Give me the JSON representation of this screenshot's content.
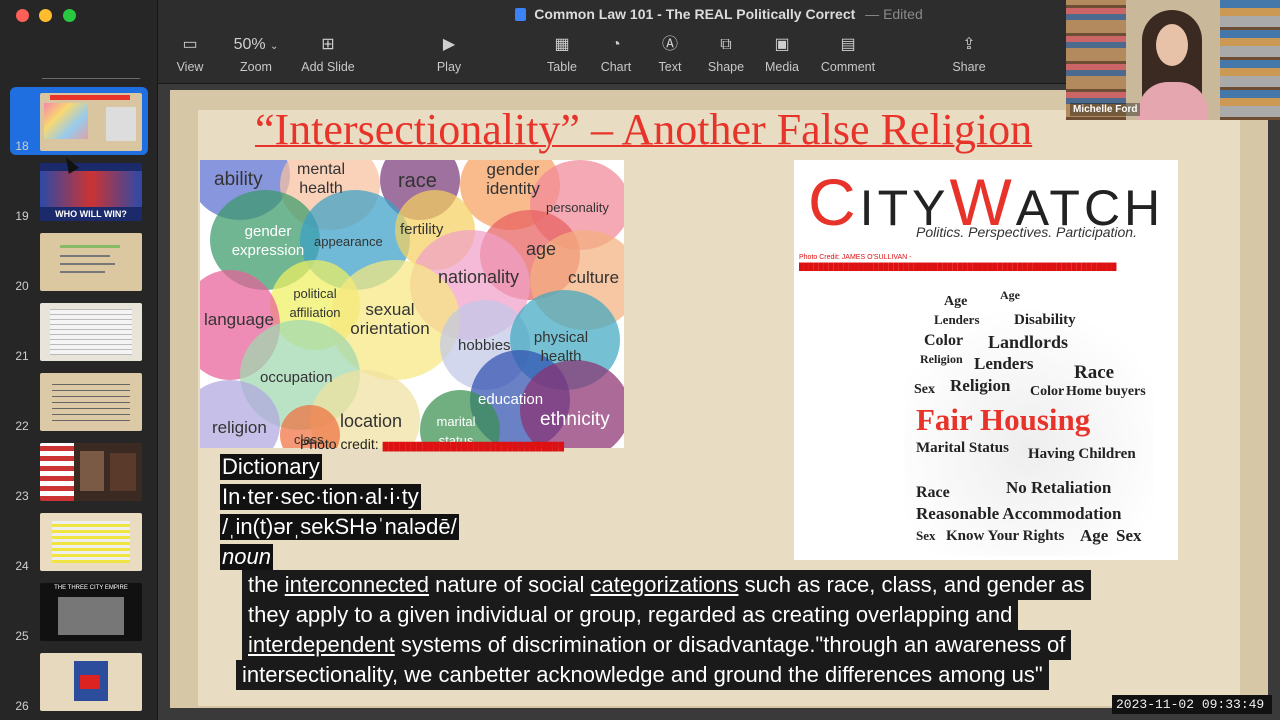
{
  "window": {
    "title": "Common Law 101 - The REAL Politically Correct",
    "separator": "—",
    "status": "Edited"
  },
  "toolbar": {
    "view": "View",
    "zoom_value": "50%",
    "zoom": "Zoom",
    "add_slide": "Add Slide",
    "play": "Play",
    "table": "Table",
    "chart": "Chart",
    "text": "Text",
    "shape": "Shape",
    "media": "Media",
    "comment": "Comment",
    "share": "Share"
  },
  "navigator": {
    "slides": [
      {
        "number": "18",
        "selected": true
      },
      {
        "number": "19",
        "caption": "WHO WILL WIN?"
      },
      {
        "number": "20"
      },
      {
        "number": "21"
      },
      {
        "number": "22"
      },
      {
        "number": "23"
      },
      {
        "number": "24"
      },
      {
        "number": "25",
        "caption": "THE THREE CITY EMPIRE"
      },
      {
        "number": "26"
      }
    ]
  },
  "slide": {
    "title": "“Intersectionality” – Another False Religion",
    "bubbles": [
      "ability",
      "mental health",
      "race",
      "gender identity",
      "personality",
      "gender expression",
      "appearance",
      "fertility",
      "age",
      "nationality",
      "culture",
      "political affiliation",
      "language",
      "sexual orientation",
      "hobbies",
      "physical health",
      "occupation",
      "education",
      "religion",
      "location",
      "marital status",
      "class",
      "ethnicity"
    ],
    "photo_credit": "Photo credit:",
    "citywatch": {
      "logo_c": "C",
      "logo_ity": "ITY",
      "logo_w": "W",
      "logo_atch": "ATCH",
      "tagline": "Politics. Perspectives. Participation.",
      "credit": "Photo Credit: JAMES O'SULLIVAN -",
      "words": [
        "Age",
        "Age",
        "Lenders",
        "Disability",
        "Color",
        "Landlords",
        "Religion",
        "Lenders",
        "Race",
        "Sex",
        "Religion",
        "Color",
        "Home buyers",
        "Fair Housing",
        "Marital Status",
        "Having Children",
        "Race",
        "No Retaliation",
        "Reasonable Accommodation",
        "Sex",
        "Know Your Rights",
        "Age",
        "Sex"
      ],
      "colors": {
        "red": "#e8332a"
      }
    },
    "dictionary": {
      "heading": "Dictionary",
      "word": "In·ter·sec·tion·al·i·ty",
      "pronunciation": "/ˌin(t)ərˌsekSHəˈnalədē/",
      "pos": "noun",
      "def1_a": "the ",
      "def1_u1": "interconnected",
      "def1_b": " nature of social ",
      "def1_u2": "categorizations",
      "def1_c": " such as race, class, and gender as",
      "def2": "they apply to a given individual or group, regarded as creating overlapping and",
      "def3_u": "interdependent",
      "def3_b": " systems of discrimination or disadvantage.\"through an awareness of",
      "def4": "intersectionality, we canbetter acknowledge and ground the differences among us\""
    }
  },
  "video": {
    "participant": "Michelle Ford"
  },
  "timestamp": "2023-11-02  09:33:49"
}
